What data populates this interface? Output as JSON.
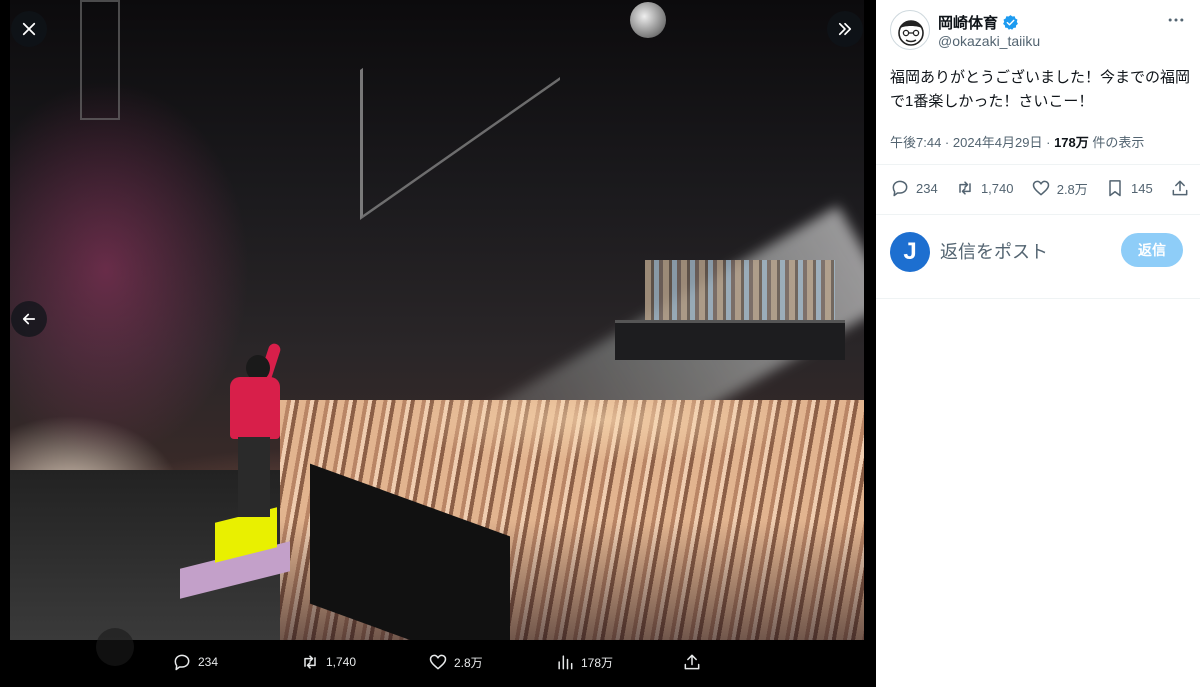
{
  "viewer": {
    "close_icon": "close-icon",
    "expand_icon": "chevrons-right-icon",
    "prev_icon": "arrow-left-icon"
  },
  "actions": {
    "reply_count": "234",
    "repost_count": "1,740",
    "like_count": "2.8万",
    "view_count": "178万"
  },
  "tweet": {
    "display_name": "岡崎体育",
    "handle": "@okazaki_taiiku",
    "text": "福岡ありがとうございました！今までの福岡で1番楽しかった！さいこー！",
    "time": "午後7:44",
    "sep": " · ",
    "date": "2024年4月29日",
    "views_num": "178万",
    "views_label": " 件の表示",
    "stats": {
      "replies": "234",
      "reposts": "1,740",
      "likes": "2.8万",
      "bookmarks": "145"
    }
  },
  "reply": {
    "avatar_letter": "J",
    "placeholder": "返信をポスト",
    "button": "返信"
  },
  "colors": {
    "accent": "#1d9bf0",
    "reply_button_disabled": "#8ecdf8",
    "verified": "#1d9bf0"
  }
}
